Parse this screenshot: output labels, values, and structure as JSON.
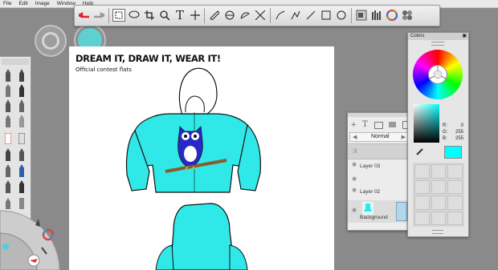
{
  "menu": {
    "file": "File",
    "edit": "Edit",
    "image": "Image",
    "window": "Window",
    "help": "Help"
  },
  "canvas": {
    "title": "DREAM IT, DRAW IT, WEAR IT!",
    "subtitle": "Official contest flats",
    "hoodie_color": "#31e8e8"
  },
  "layers": {
    "blend_mode": "Normal",
    "items": [
      {
        "name": "Layer 03",
        "visible": true
      },
      {
        "name": "Layer 02",
        "visible": true
      },
      {
        "name": "Background",
        "visible": true
      }
    ]
  },
  "colors": {
    "title": "Colors",
    "r_label": "R:",
    "r_value": "0",
    "g_label": "G:",
    "g_value": "255",
    "b_label": "B:",
    "b_value": "255",
    "current": "#00ffff"
  },
  "icons": [
    "undo-icon",
    "redo-icon",
    "rectangle-select-icon",
    "lasso-icon",
    "crop-icon",
    "zoom-icon",
    "text-icon",
    "move-icon",
    "ruler-icon",
    "symmetry-icon",
    "french-curve-icon",
    "transform-icon",
    "line-icon",
    "straight-line-icon",
    "rectangle-icon",
    "ellipse-icon",
    "layer-thumbnail-icon",
    "brush-library-icon",
    "color-wheel-icon",
    "copic-library-icon"
  ]
}
